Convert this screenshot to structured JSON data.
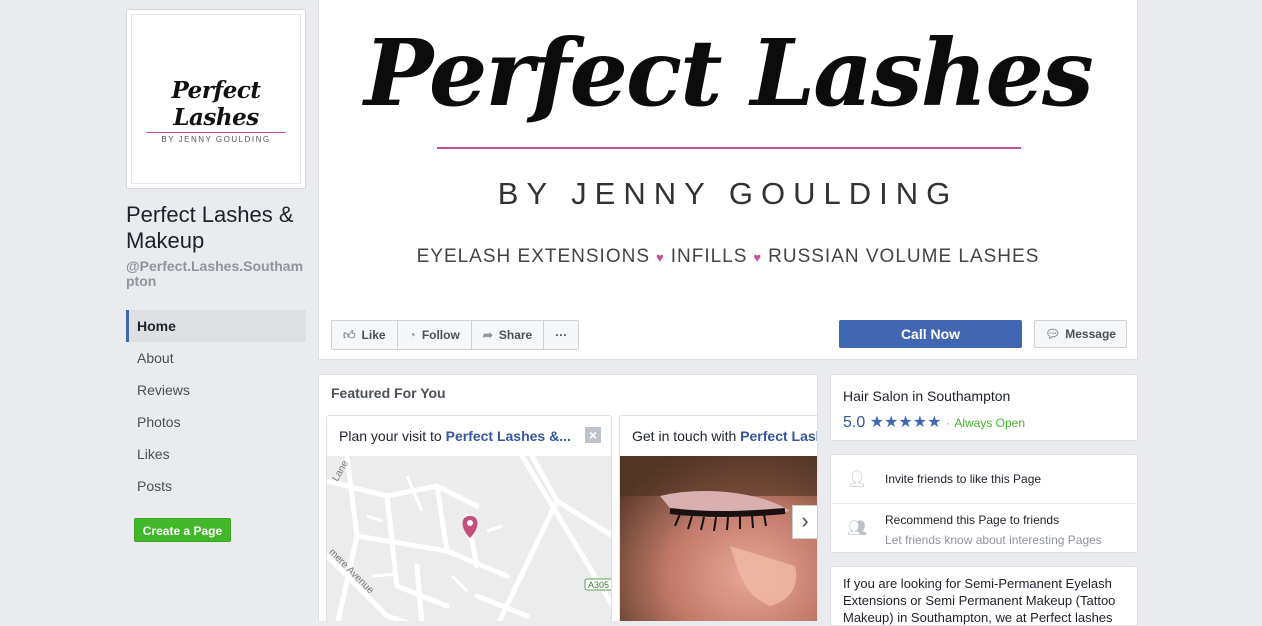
{
  "profile": {
    "logo_script": "Perfect Lashes",
    "logo_by": "BY JENNY GOULDING",
    "name": "Perfect Lashes & Makeup",
    "handle": "@Perfect.Lashes.Southampton"
  },
  "nav": {
    "items": [
      {
        "label": "Home",
        "active": true
      },
      {
        "label": "About"
      },
      {
        "label": "Reviews"
      },
      {
        "label": "Photos"
      },
      {
        "label": "Likes"
      },
      {
        "label": "Posts"
      }
    ],
    "create_page": "Create a Page"
  },
  "cover": {
    "title": "Perfect Lashes",
    "by_line": "BY JENNY GOULDING",
    "services": [
      "EYELASH EXTENSIONS",
      "INFILLS",
      "RUSSIAN VOLUME LASHES"
    ],
    "accent": "#c2519b"
  },
  "actions": {
    "like": "Like",
    "follow": "Follow",
    "share": "Share",
    "more": "···",
    "call_now": "Call Now",
    "message": "Message"
  },
  "featured": {
    "title": "Featured For You",
    "cards": [
      {
        "prefix": "Plan your visit to ",
        "link": "Perfect Lashes &...",
        "map_labels": [
          "Lane",
          "mere Avenue",
          "A305"
        ]
      },
      {
        "prefix": "Get in touch with ",
        "link": "Perfect Lash"
      }
    ]
  },
  "info": {
    "category": "Hair Salon in Southampton",
    "rating": "5.0",
    "stars": "★★★★★",
    "separator": "·",
    "status": "Always Open"
  },
  "invite": {
    "invite_label": "Invite friends to like this Page",
    "recommend_label": "Recommend this Page to friends",
    "recommend_sub": "Let friends know about interesting Pages"
  },
  "about": {
    "text": "If you are looking for Semi-Permanent Eyelash Extensions or Semi Permanent Makeup (Tattoo Makeup) in Southampton, we at Perfect lashes"
  }
}
